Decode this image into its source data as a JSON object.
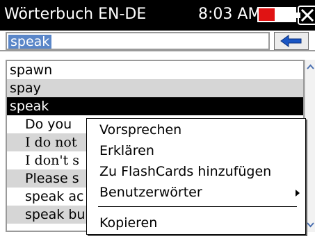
{
  "titlebar": {
    "title": "Wörterbuch EN-DE",
    "clock": "8:03 AM",
    "battery_level": 0.45,
    "battery_color": "#e01313",
    "close_icon": "close-icon"
  },
  "search": {
    "value": "speak",
    "back_icon": "arrow-left-icon"
  },
  "list": {
    "items": [
      {
        "text": "spawn"
      },
      {
        "text": "spay"
      },
      {
        "text": "speak"
      },
      {
        "text": "Do you"
      },
      {
        "text": "I do not"
      },
      {
        "text": "I don't s"
      },
      {
        "text": "Please s"
      },
      {
        "text": "speak ac"
      },
      {
        "text": "speak bu"
      }
    ],
    "selected_index": 2
  },
  "context_menu": {
    "items": [
      {
        "label": "Vorsprechen"
      },
      {
        "label": "Erklären"
      },
      {
        "label": "Zu FlashCards hinzufügen"
      },
      {
        "label": "Benutzerwörter"
      },
      {
        "label": "Kopieren"
      }
    ]
  },
  "colors": {
    "selection": "#5a86c8",
    "row_alt": "#d6d6d6",
    "row_selected": "#000000",
    "titlebar": "#000000"
  }
}
